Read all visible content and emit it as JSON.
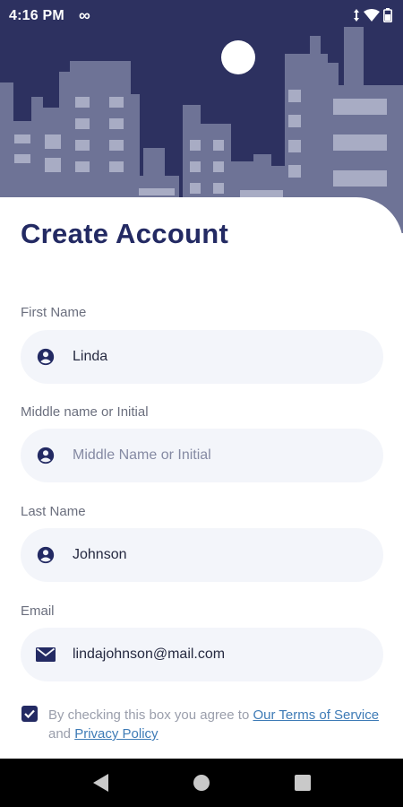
{
  "status_bar": {
    "time": "4:16 PM",
    "infinity_icon": "infinity-icon",
    "icons": [
      "data-arrows-icon",
      "wifi-icon",
      "battery-icon"
    ]
  },
  "colors": {
    "navy": "#232a63",
    "sky": "#2d3160",
    "building": "#6e7396",
    "building_window": "#a8acc4",
    "moon": "#ffffff",
    "field_bg": "#f3f5fa",
    "link": "#3e7bb6"
  },
  "form": {
    "title": "Create Account",
    "fields": [
      {
        "label": "First Name",
        "value": "Linda",
        "placeholder": "First Name",
        "icon": "person-icon"
      },
      {
        "label": "Middle name or Initial",
        "value": "",
        "placeholder": "Middle Name or Initial",
        "icon": "person-icon"
      },
      {
        "label": "Last Name",
        "value": "Johnson",
        "placeholder": "Last Name",
        "icon": "person-icon"
      },
      {
        "label": "Email",
        "value": "lindajohnson@mail.com",
        "placeholder": "Email",
        "icon": "mail-icon"
      }
    ],
    "terms": {
      "checked": true,
      "text_before": "By checking this box you agree to ",
      "terms_link": "Our Terms of Service",
      "text_between": " and ",
      "privacy_link": "Privacy Policy"
    }
  },
  "nav_bar": {
    "buttons": [
      "back-icon",
      "home-icon",
      "recents-icon"
    ]
  }
}
